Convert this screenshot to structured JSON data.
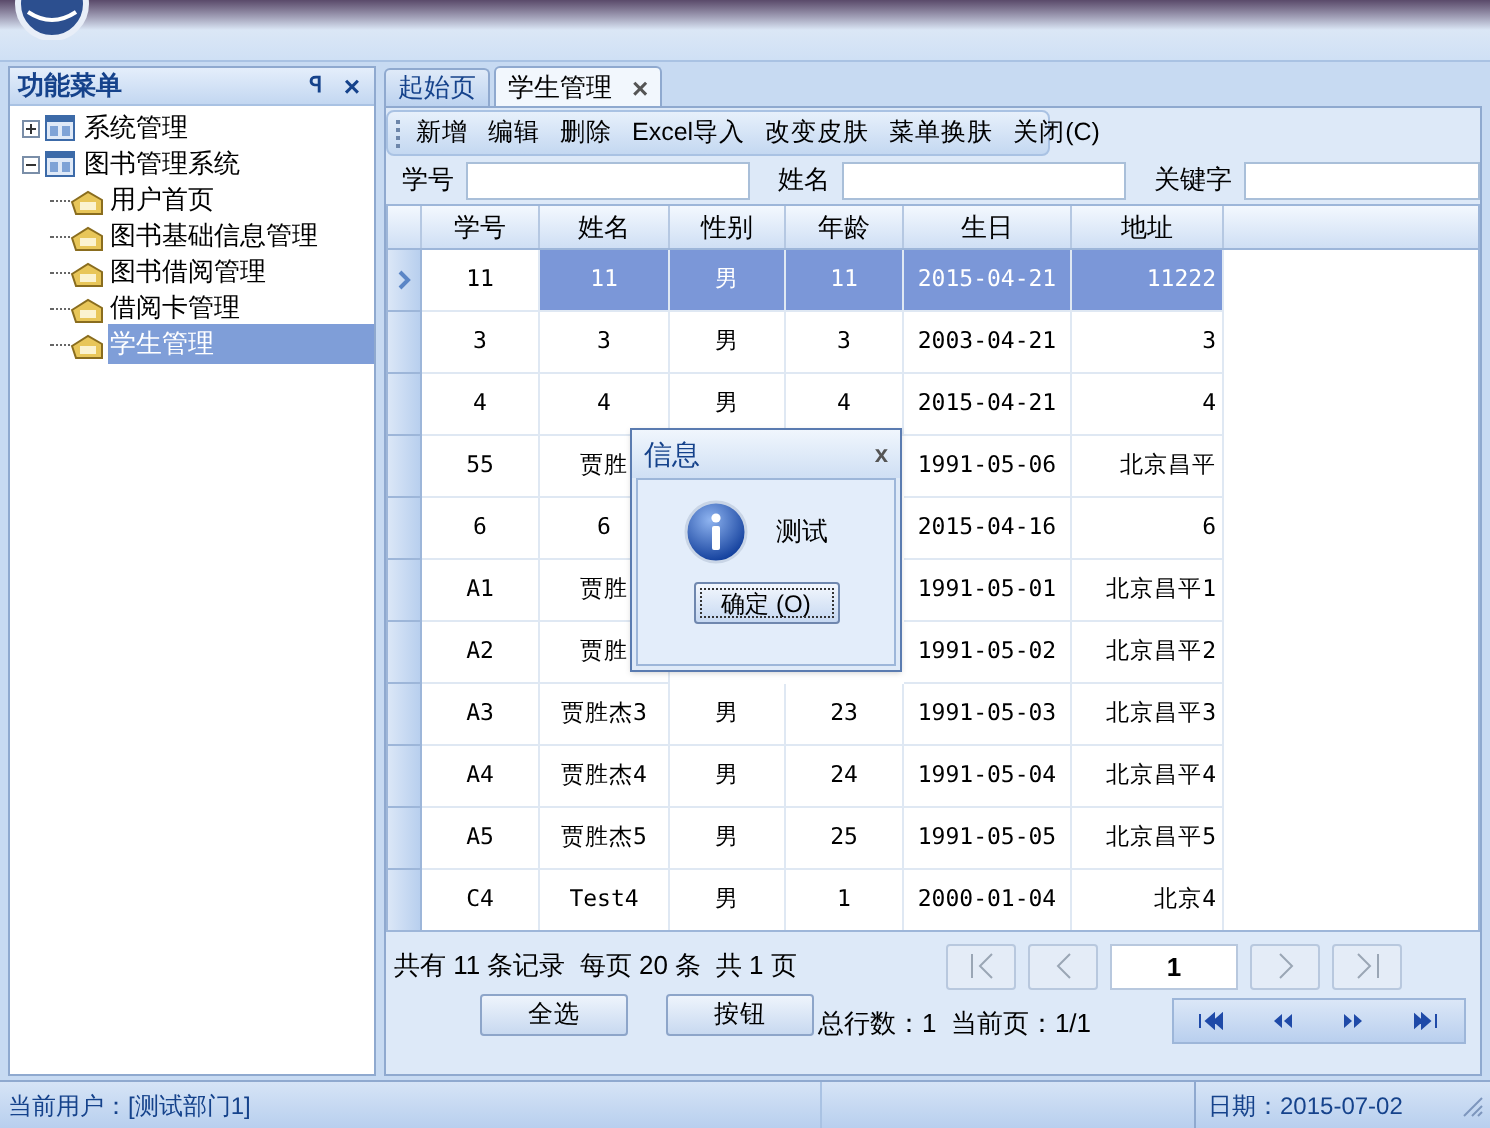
{
  "sidebar": {
    "title": "功能菜单",
    "pin": "ꟼ",
    "close": "×",
    "items": [
      {
        "label": "系统管理",
        "expanded": false,
        "selected": false
      },
      {
        "label": "图书管理系统",
        "expanded": true,
        "selected": false,
        "children": [
          {
            "label": "用户首页",
            "selected": false
          },
          {
            "label": "图书基础信息管理",
            "selected": false
          },
          {
            "label": "图书借阅管理",
            "selected": false
          },
          {
            "label": "借阅卡管理",
            "selected": false
          },
          {
            "label": "学生管理",
            "selected": true
          }
        ]
      }
    ]
  },
  "tabs": [
    {
      "label": "起始页",
      "selected": false
    },
    {
      "label": "学生管理",
      "selected": true,
      "close": "×"
    }
  ],
  "toolbar": [
    "新增",
    "编辑",
    "删除",
    "Excel导入",
    "改变皮肤",
    "菜单换肤",
    "关闭(C)"
  ],
  "search": [
    {
      "label": "学号"
    },
    {
      "label": "姓名"
    },
    {
      "label": "关键字"
    }
  ],
  "table": {
    "columns": [
      "学号",
      "姓名",
      "性别",
      "年龄",
      "生日",
      "地址"
    ],
    "rows": [
      {
        "selected": true,
        "id": "11",
        "name": "11",
        "gender": "男",
        "age": "11",
        "birthday": "2015-04-21",
        "address": "11222"
      },
      {
        "selected": false,
        "id": "3",
        "name": "3",
        "gender": "男",
        "age": "3",
        "birthday": "2003-04-21",
        "address": "3"
      },
      {
        "selected": false,
        "id": "4",
        "name": "4",
        "gender": "男",
        "age": "4",
        "birthday": "2015-04-21",
        "address": "4"
      },
      {
        "selected": false,
        "id": "55",
        "name": "贾胜",
        "birthday": "1991-05-06",
        "address": "北京昌平"
      },
      {
        "selected": false,
        "id": "6",
        "name": "6",
        "birthday": "2015-04-16",
        "address": "6"
      },
      {
        "selected": false,
        "id": "A1",
        "name": "贾胜",
        "birthday": "1991-05-01",
        "address": "北京昌平1"
      },
      {
        "selected": false,
        "id": "A2",
        "name": "贾胜",
        "birthday": "1991-05-02",
        "address": "北京昌平2"
      },
      {
        "selected": false,
        "id": "A3",
        "name": "贾胜杰3",
        "gender": "男",
        "age": "23",
        "birthday": "1991-05-03",
        "address": "北京昌平3"
      },
      {
        "selected": false,
        "id": "A4",
        "name": "贾胜杰4",
        "gender": "男",
        "age": "24",
        "birthday": "1991-05-04",
        "address": "北京昌平4"
      },
      {
        "selected": false,
        "id": "A5",
        "name": "贾胜杰5",
        "gender": "男",
        "age": "25",
        "birthday": "1991-05-05",
        "address": "北京昌平5"
      },
      {
        "selected": false,
        "id": "C4",
        "name": "Test4",
        "gender": "男",
        "age": "1",
        "birthday": "2000-01-04",
        "address": "北京4"
      }
    ]
  },
  "dialog": {
    "title": "信息",
    "close": "x",
    "message": "测试",
    "button": "确定 (O)"
  },
  "pager": {
    "summary": "共有 11 条记录  每页 20 条  共 1 页",
    "page": "1",
    "buttons": [
      "全选",
      "按钮"
    ],
    "totals": "总行数：1  当前页：1/1"
  },
  "status_bar": {
    "user": "当前用户：[测试部门1]",
    "date": "日期：2015-07-02"
  }
}
